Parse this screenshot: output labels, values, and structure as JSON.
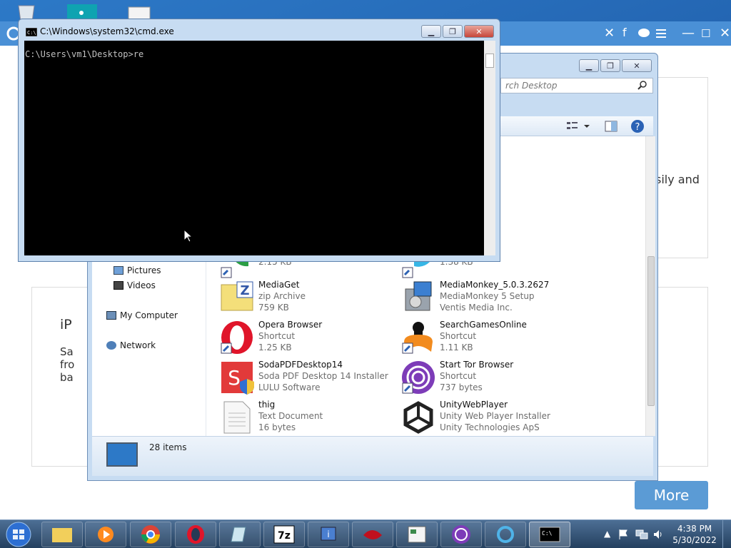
{
  "desktop": {
    "icons": [
      "recycle-bin-icon",
      "app-icon",
      "document-icon"
    ]
  },
  "browser": {
    "close_glyph": "✕",
    "card_text_1": "sily and",
    "card_text_2": "iP",
    "card_text_3": [
      "Sa",
      "fro",
      "ba"
    ],
    "more_label": "More"
  },
  "cmd": {
    "title": "C:\\Windows\\system32\\cmd.exe",
    "prompt_line": "C:\\Users\\vm1\\Desktop>re"
  },
  "explorer": {
    "search_placeholder": "rch Desktop",
    "nav": [
      {
        "label": "Pictures",
        "icon": "pictures-icon"
      },
      {
        "label": "Videos",
        "icon": "videos-icon"
      },
      {
        "label": "My Computer",
        "icon": "computer-icon"
      },
      {
        "label": "Network",
        "icon": "network-icon"
      }
    ],
    "files": [
      {
        "name": "",
        "type": "",
        "detail": "2.15 KB",
        "icon": "chrome-shortcut-icon"
      },
      {
        "name": "",
        "type": "",
        "detail": "1.38 KB",
        "icon": "shortcut-icon"
      },
      {
        "name": "MediaGet",
        "type": "zip Archive",
        "detail": "759 KB",
        "icon": "zip-archive-icon"
      },
      {
        "name": "MediaMonkey_5.0.3.2627",
        "type": "MediaMonkey 5 Setup",
        "detail": "Ventis Media Inc.",
        "icon": "installer-icon"
      },
      {
        "name": "Opera Browser",
        "type": "Shortcut",
        "detail": "1.25 KB",
        "icon": "opera-icon"
      },
      {
        "name": "SearchGamesOnline",
        "type": "Shortcut",
        "detail": "1.11 KB",
        "icon": "gamepad-icon"
      },
      {
        "name": "SodaPDFDesktop14",
        "type": "Soda PDF Desktop 14 Installer",
        "detail": "LULU Software",
        "icon": "sodapdf-icon"
      },
      {
        "name": "Start Tor Browser",
        "type": "Shortcut",
        "detail": "737 bytes",
        "icon": "tor-icon"
      },
      {
        "name": "thig",
        "type": "Text Document",
        "detail": "16 bytes",
        "icon": "text-document-icon"
      },
      {
        "name": "UnityWebPlayer",
        "type": "Unity Web Player Installer",
        "detail": "Unity Technologies ApS",
        "icon": "unity-icon"
      }
    ],
    "status": "28 items"
  },
  "taskbar": {
    "time": "4:38 PM",
    "date": "5/30/2022"
  }
}
